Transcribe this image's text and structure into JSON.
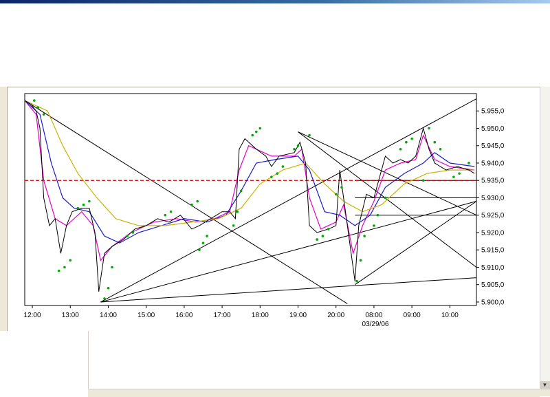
{
  "chart_data": {
    "type": "line",
    "title": "",
    "xlabel": "",
    "ylabel": "",
    "date_label": "03/29/06",
    "x_ticks": [
      "12:00",
      "13:00",
      "14:00",
      "15:00",
      "16:00",
      "17:00",
      "18:00",
      "19:00",
      "20:00",
      "08:00",
      "09:00",
      "10:00"
    ],
    "y_ticks": [
      "5.900,0",
      "5.905,0",
      "5.910,0",
      "5.915,0",
      "5.920,0",
      "5.925,0",
      "5.930,0",
      "5.935,0",
      "5.940,0",
      "5.945,0",
      "5.950,0",
      "5.955,0"
    ],
    "y_tick_values": [
      5900,
      5905,
      5910,
      5915,
      5920,
      5925,
      5930,
      5935,
      5940,
      5945,
      5950,
      5955
    ],
    "ylim": [
      5899,
      5960
    ],
    "xlim": [
      -0.2,
      11.7
    ],
    "reference_line": {
      "value": 5935,
      "label": "5.935,0",
      "color": "#cc0000"
    },
    "price": {
      "name": "",
      "color": "#000000",
      "points": [
        [
          -0.2,
          5958
        ],
        [
          -0.05,
          5957
        ],
        [
          0.1,
          5955
        ],
        [
          0.2,
          5950
        ],
        [
          0.3,
          5930
        ],
        [
          0.45,
          5922
        ],
        [
          0.6,
          5924
        ],
        [
          0.75,
          5914
        ],
        [
          0.9,
          5922
        ],
        [
          1.05,
          5926
        ],
        [
          1.3,
          5927
        ],
        [
          1.5,
          5927
        ],
        [
          1.65,
          5920
        ],
        [
          1.75,
          5903
        ],
        [
          1.9,
          5914
        ],
        [
          2.1,
          5916
        ],
        [
          2.4,
          5918
        ],
        [
          2.7,
          5921
        ],
        [
          3.0,
          5922
        ],
        [
          3.3,
          5924
        ],
        [
          3.6,
          5923
        ],
        [
          3.9,
          5925
        ],
        [
          4.2,
          5921
        ],
        [
          4.4,
          5922
        ],
        [
          4.7,
          5924
        ],
        [
          5.0,
          5926
        ],
        [
          5.2,
          5926
        ],
        [
          5.35,
          5924
        ],
        [
          5.45,
          5944
        ],
        [
          5.6,
          5947
        ],
        [
          5.9,
          5944
        ],
        [
          6.15,
          5942
        ],
        [
          6.3,
          5939
        ],
        [
          6.5,
          5942
        ],
        [
          6.9,
          5943
        ],
        [
          7.05,
          5946
        ],
        [
          7.2,
          5940
        ],
        [
          7.3,
          5922
        ],
        [
          7.5,
          5920
        ],
        [
          7.8,
          5921
        ],
        [
          8.0,
          5922
        ],
        [
          8.1,
          5938
        ],
        [
          8.25,
          5926
        ],
        [
          8.4,
          5914
        ],
        [
          8.5,
          5906
        ],
        [
          8.6,
          5922
        ],
        [
          8.8,
          5931
        ],
        [
          9.0,
          5930
        ],
        [
          9.15,
          5936
        ],
        [
          9.3,
          5942
        ],
        [
          9.5,
          5940
        ],
        [
          9.7,
          5941
        ],
        [
          9.9,
          5940
        ],
        [
          10.1,
          5942
        ],
        [
          10.3,
          5950
        ],
        [
          10.45,
          5944
        ],
        [
          10.6,
          5940
        ],
        [
          10.9,
          5938
        ],
        [
          11.2,
          5939
        ],
        [
          11.5,
          5938
        ],
        [
          11.65,
          5937
        ]
      ]
    },
    "moving_averages": [
      {
        "name": "",
        "color": "#e600c8",
        "points": [
          [
            -0.2,
            5958
          ],
          [
            0.1,
            5954
          ],
          [
            0.3,
            5935
          ],
          [
            0.6,
            5924
          ],
          [
            0.9,
            5922
          ],
          [
            1.3,
            5926
          ],
          [
            1.6,
            5922
          ],
          [
            1.8,
            5912
          ],
          [
            2.1,
            5916
          ],
          [
            2.6,
            5920
          ],
          [
            3.2,
            5923
          ],
          [
            3.8,
            5924
          ],
          [
            4.3,
            5923
          ],
          [
            4.8,
            5924
          ],
          [
            5.2,
            5926
          ],
          [
            5.45,
            5938
          ],
          [
            5.7,
            5945
          ],
          [
            6.3,
            5942
          ],
          [
            6.9,
            5942
          ],
          [
            7.1,
            5944
          ],
          [
            7.3,
            5930
          ],
          [
            7.6,
            5921
          ],
          [
            8.0,
            5923
          ],
          [
            8.2,
            5928
          ],
          [
            8.45,
            5914
          ],
          [
            8.7,
            5922
          ],
          [
            9.0,
            5929
          ],
          [
            9.3,
            5938
          ],
          [
            9.7,
            5940
          ],
          [
            10.1,
            5941
          ],
          [
            10.3,
            5948
          ],
          [
            10.6,
            5941
          ],
          [
            11.0,
            5939
          ],
          [
            11.65,
            5938
          ]
        ]
      },
      {
        "name": "",
        "color": "#1a1acc",
        "points": [
          [
            -0.2,
            5958
          ],
          [
            0.2,
            5954
          ],
          [
            0.5,
            5940
          ],
          [
            0.8,
            5930
          ],
          [
            1.1,
            5927
          ],
          [
            1.5,
            5926
          ],
          [
            1.9,
            5919
          ],
          [
            2.3,
            5917
          ],
          [
            2.8,
            5920
          ],
          [
            3.4,
            5922
          ],
          [
            4.0,
            5924
          ],
          [
            4.6,
            5923
          ],
          [
            5.1,
            5925
          ],
          [
            5.5,
            5932
          ],
          [
            5.9,
            5940
          ],
          [
            6.4,
            5941
          ],
          [
            7.0,
            5942
          ],
          [
            7.3,
            5938
          ],
          [
            7.7,
            5926
          ],
          [
            8.1,
            5925
          ],
          [
            8.5,
            5922
          ],
          [
            8.9,
            5925
          ],
          [
            9.3,
            5933
          ],
          [
            9.8,
            5937
          ],
          [
            10.3,
            5940
          ],
          [
            10.6,
            5943
          ],
          [
            11.0,
            5940
          ],
          [
            11.65,
            5939
          ]
        ]
      },
      {
        "name": "",
        "color": "#c8b400",
        "points": [
          [
            -0.2,
            5958
          ],
          [
            0.4,
            5955
          ],
          [
            0.8,
            5945
          ],
          [
            1.2,
            5937
          ],
          [
            1.7,
            5930
          ],
          [
            2.2,
            5924
          ],
          [
            2.8,
            5922
          ],
          [
            3.5,
            5922
          ],
          [
            4.2,
            5923
          ],
          [
            4.9,
            5924
          ],
          [
            5.5,
            5927
          ],
          [
            6.0,
            5934
          ],
          [
            6.6,
            5938
          ],
          [
            7.2,
            5940
          ],
          [
            7.7,
            5934
          ],
          [
            8.2,
            5929
          ],
          [
            8.7,
            5926
          ],
          [
            9.2,
            5928
          ],
          [
            9.8,
            5934
          ],
          [
            10.4,
            5937
          ],
          [
            11.0,
            5938
          ],
          [
            11.65,
            5938
          ]
        ]
      }
    ],
    "parabolic_sar": {
      "name": "",
      "color": "#00aa00",
      "points": [
        [
          0.05,
          5958
        ],
        [
          0.15,
          5956
        ],
        [
          0.3,
          5954
        ],
        [
          0.7,
          5909
        ],
        [
          0.85,
          5910
        ],
        [
          1.0,
          5912
        ],
        [
          1.2,
          5927
        ],
        [
          1.35,
          5928
        ],
        [
          1.5,
          5929
        ],
        [
          1.9,
          5901
        ],
        [
          2.0,
          5904
        ],
        [
          2.1,
          5910
        ],
        [
          2.5,
          5919
        ],
        [
          2.65,
          5920
        ],
        [
          3.5,
          5925
        ],
        [
          3.65,
          5926
        ],
        [
          4.2,
          5928
        ],
        [
          4.35,
          5929
        ],
        [
          4.4,
          5915
        ],
        [
          4.5,
          5917
        ],
        [
          4.6,
          5919
        ],
        [
          5.3,
          5922
        ],
        [
          5.4,
          5926
        ],
        [
          5.5,
          5932
        ],
        [
          5.8,
          5948
        ],
        [
          5.9,
          5949
        ],
        [
          6.0,
          5950
        ],
        [
          6.3,
          5936
        ],
        [
          6.45,
          5937
        ],
        [
          6.6,
          5939
        ],
        [
          6.9,
          5944
        ],
        [
          7.0,
          5945
        ],
        [
          7.3,
          5948
        ],
        [
          7.5,
          5918
        ],
        [
          7.65,
          5919
        ],
        [
          7.8,
          5921
        ],
        [
          8.0,
          5931
        ],
        [
          8.15,
          5933
        ],
        [
          8.55,
          5906
        ],
        [
          8.65,
          5912
        ],
        [
          8.75,
          5919
        ],
        [
          9.0,
          5922
        ],
        [
          9.1,
          5925
        ],
        [
          9.3,
          5930
        ],
        [
          9.7,
          5944
        ],
        [
          9.85,
          5946
        ],
        [
          10.0,
          5947
        ],
        [
          10.3,
          5935
        ],
        [
          10.45,
          5950
        ],
        [
          10.6,
          5946
        ],
        [
          10.75,
          5944
        ],
        [
          11.1,
          5936
        ],
        [
          11.25,
          5937
        ],
        [
          11.5,
          5940
        ]
      ]
    },
    "trend_lines": [
      {
        "from": [
          -0.2,
          5958
        ],
        "to": [
          8.3,
          5899.5
        ]
      },
      {
        "from": [
          1.8,
          5900
        ],
        "to": [
          11.7,
          5958.5
        ]
      },
      {
        "from": [
          1.8,
          5900
        ],
        "to": [
          11.7,
          5929
        ]
      },
      {
        "from": [
          1.8,
          5900
        ],
        "to": [
          11.7,
          5907
        ]
      },
      {
        "from": [
          7.0,
          5949
        ],
        "to": [
          11.7,
          5925
        ]
      },
      {
        "from": [
          7.0,
          5949
        ],
        "to": [
          11.7,
          5910
        ]
      },
      {
        "from": [
          8.5,
          5905
        ],
        "to": [
          11.7,
          5929
        ]
      },
      {
        "from": [
          8.5,
          5935
        ],
        "to": [
          11.7,
          5935
        ]
      },
      {
        "from": [
          8.5,
          5930
        ],
        "to": [
          11.7,
          5930
        ]
      },
      {
        "from": [
          8.5,
          5925
        ],
        "to": [
          11.7,
          5925
        ]
      }
    ]
  }
}
